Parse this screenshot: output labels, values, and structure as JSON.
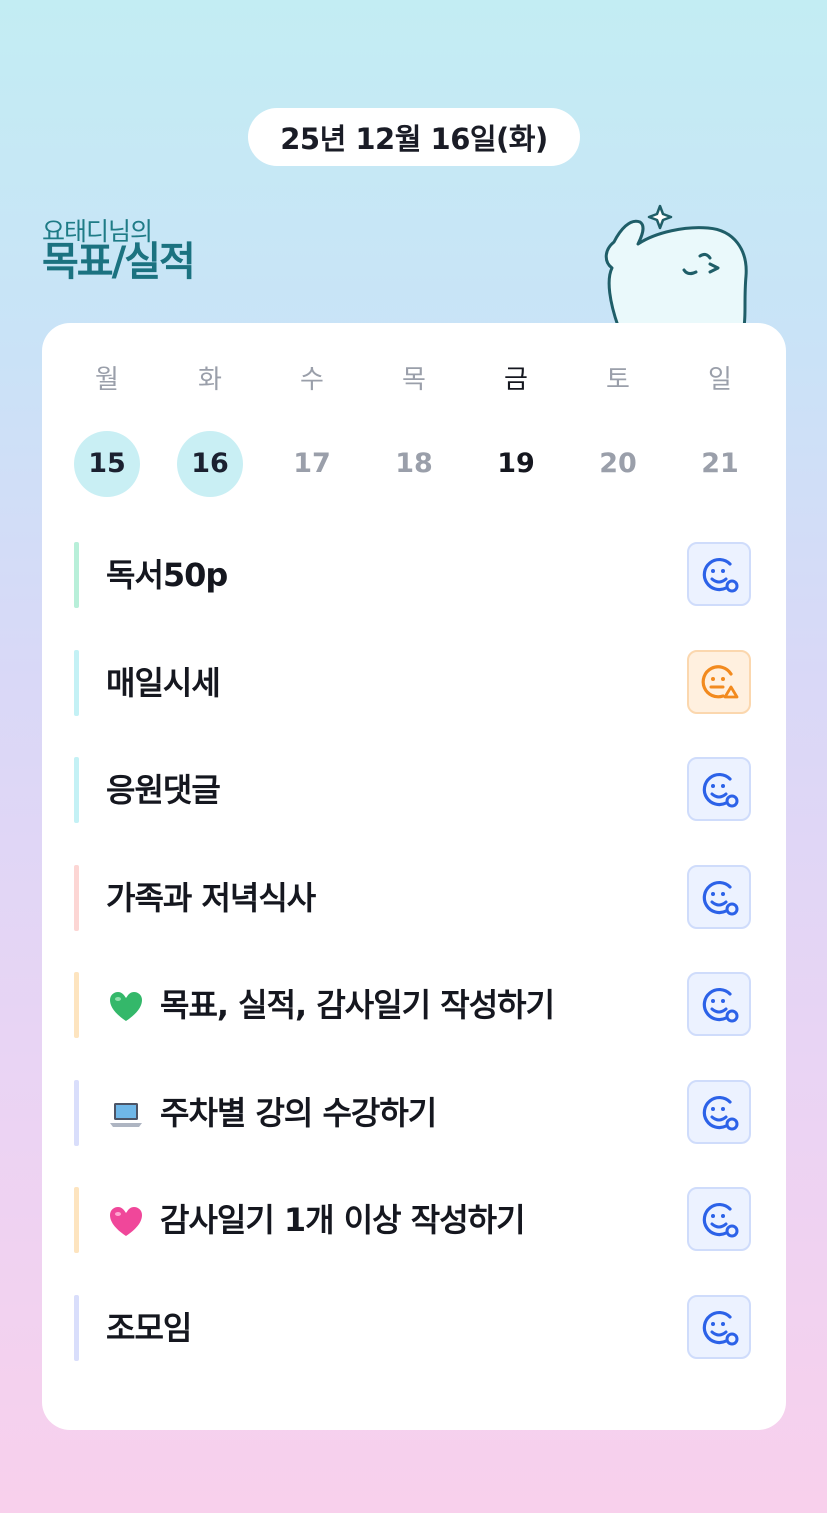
{
  "header": {
    "date": "25년 12월 16일(화)",
    "owner": "요태디님의",
    "title": "목표/실적"
  },
  "week": [
    {
      "label": "월",
      "num": "15",
      "state": "done"
    },
    {
      "label": "화",
      "num": "16",
      "state": "done"
    },
    {
      "label": "수",
      "num": "17",
      "state": "upcoming"
    },
    {
      "label": "목",
      "num": "18",
      "state": "upcoming"
    },
    {
      "label": "금",
      "num": "19",
      "state": "today"
    },
    {
      "label": "토",
      "num": "20",
      "state": "upcoming"
    },
    {
      "label": "일",
      "num": "21",
      "state": "upcoming"
    }
  ],
  "tasks": [
    {
      "text": "독서50p",
      "bar_color": "#b8efd9",
      "status": "smile-check-icon",
      "emoji": ""
    },
    {
      "text": "매일시세",
      "bar_color": "#c4f1f5",
      "status": "meh-warning-icon",
      "emoji": ""
    },
    {
      "text": "응원댓글",
      "bar_color": "#c4f1f5",
      "status": "smile-check-icon",
      "emoji": ""
    },
    {
      "text": "가족과 저녁식사",
      "bar_color": "#fcd6d4",
      "status": "smile-check-icon",
      "emoji": ""
    },
    {
      "text": "목표, 실적, 감사일기 작성하기",
      "bar_color": "#fde4bf",
      "status": "smile-check-icon",
      "emoji": "green-heart-icon"
    },
    {
      "text": "주차별 강의 수강하기",
      "bar_color": "#d9defb",
      "status": "smile-check-icon",
      "emoji": "laptop-icon"
    },
    {
      "text": "감사일기 1개 이상 작성하기",
      "bar_color": "#fde4bf",
      "status": "smile-check-icon",
      "emoji": "pink-heart-icon"
    },
    {
      "text": "조모임",
      "bar_color": "#d9defb",
      "status": "smile-check-icon",
      "emoji": ""
    }
  ],
  "colors": {
    "accent_teal": "#1b7280",
    "done_circle": "#c9eff4",
    "status_blue": "#2c62e8",
    "status_orange": "#f28a1e"
  }
}
